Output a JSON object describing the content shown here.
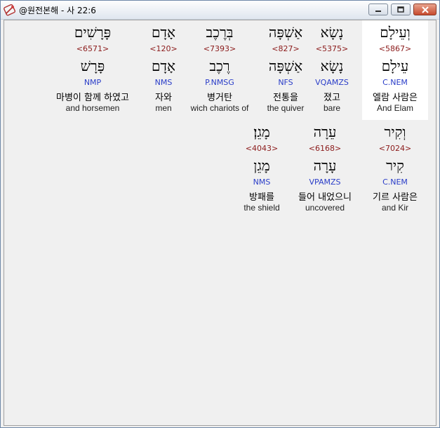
{
  "window": {
    "title": "@원전본해 - 사 22:6",
    "icon": "bible-app-icon"
  },
  "controls": {
    "minimize": "minimize-icon",
    "maximize": "maximize-icon",
    "close": "close-icon"
  },
  "words": [
    {
      "hebrew": "וְעֵילָם",
      "strong": "<5867>",
      "root": "עֵילָם",
      "parse": "C.NEM",
      "korean": "엘람 사람은",
      "english": "And Elam",
      "selected": true
    },
    {
      "hebrew": "נָשָׂא",
      "strong": "<5375>",
      "root": "נָשָׂא",
      "parse": "VQAMZS",
      "korean": "졌고",
      "english": "bare",
      "selected": false
    },
    {
      "hebrew": "אַשְׁפָּה",
      "strong": "<827>",
      "root": "אַשְׁפָּה",
      "parse": "NFS",
      "korean": "전통을",
      "english": "the quiver",
      "selected": false
    },
    {
      "hebrew": "בְּרֶכֶב",
      "strong": "<7393>",
      "root": "רֶכֶב",
      "parse": "P.NMSG",
      "korean": "병거탄",
      "english": "wich chariots of",
      "selected": false
    },
    {
      "hebrew": "אָדָם",
      "strong": "<120>",
      "root": "אָדָם",
      "parse": "NMS",
      "korean": "자와",
      "english": "men",
      "selected": false
    },
    {
      "hebrew": "פָּרָשִׁים",
      "strong": "<6571>",
      "root": "פָּרָשׁ",
      "parse": "NMP",
      "korean": "마병이 함께 하였고",
      "english": "and horsemen",
      "selected": false
    },
    {
      "hebrew": "וְקִיר",
      "strong": "<7024>",
      "root": "קִיר",
      "parse": "C.NEM",
      "korean": "기르 사람은",
      "english": "and Kir",
      "selected": false
    },
    {
      "hebrew": "עֵרָה",
      "strong": "<6168>",
      "root": "עָרָה",
      "parse": "VPAMZS",
      "korean": "들어 내었으니",
      "english": "uncovered",
      "selected": false
    },
    {
      "hebrew": "מָגֵן׃",
      "strong": "<4043>",
      "root": "מָגֵן",
      "parse": "NMS",
      "korean": "방패를",
      "english": "the shield",
      "selected": false
    }
  ]
}
